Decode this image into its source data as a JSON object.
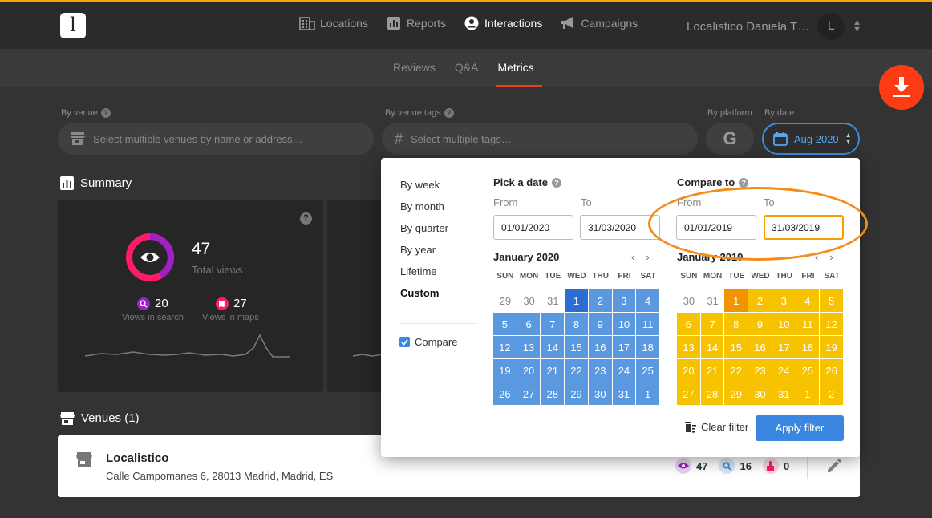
{
  "header": {
    "logo_letter": "l",
    "nav": [
      {
        "label": "Locations",
        "icon": "building-icon"
      },
      {
        "label": "Reports",
        "icon": "bar-chart-icon"
      },
      {
        "label": "Interactions",
        "icon": "user-circle-icon"
      },
      {
        "label": "Campaigns",
        "icon": "megaphone-icon"
      }
    ],
    "user_name": "Localistico Daniela T…",
    "avatar_letter": "L"
  },
  "subnav": {
    "tabs": [
      "Reviews",
      "Q&A",
      "Metrics"
    ],
    "active": "Metrics"
  },
  "filters": {
    "venue_label": "By venue",
    "venue_placeholder": "Select multiple venues by name or address…",
    "tags_label": "By venue tags",
    "tags_placeholder": "Select multiple tags…",
    "platform_label": "By platform",
    "platform_value": "G",
    "date_label": "By date",
    "date_value": "Aug 2020"
  },
  "summary": {
    "title": "Summary",
    "total_views": "47",
    "total_views_label": "Total views",
    "views_search": "20",
    "views_search_label": "Views in search",
    "views_maps": "27",
    "views_maps_label": "Views in maps",
    "help": "?"
  },
  "venues": {
    "title": "Venues (1)",
    "items": [
      {
        "name": "Localistico",
        "address": "Calle Campomanes 6, 28013 Madrid, Madrid, ES",
        "views": "47",
        "search": "16",
        "actions": "0"
      }
    ]
  },
  "date_popup": {
    "periods": [
      "By week",
      "By month",
      "By quarter",
      "By year",
      "Lifetime",
      "Custom"
    ],
    "selected_period": "Custom",
    "compare_label": "Compare",
    "pick_title": "Pick a date",
    "compare_title": "Compare to",
    "from_label": "From",
    "to_label": "To",
    "pick_from": "01/01/2020",
    "pick_to": "31/03/2020",
    "cmp_from": "01/01/2019",
    "cmp_to": "31/03/2019",
    "pick_month": "January 2020",
    "cmp_month": "January 2019",
    "dow": [
      "SUN",
      "MON",
      "TUE",
      "WED",
      "THU",
      "FRI",
      "SAT"
    ],
    "pick_days": [
      "29",
      "30",
      "31",
      "1",
      "2",
      "3",
      "4",
      "5",
      "6",
      "7",
      "8",
      "9",
      "10",
      "11",
      "12",
      "13",
      "14",
      "15",
      "16",
      "17",
      "18",
      "19",
      "20",
      "21",
      "22",
      "23",
      "24",
      "25",
      "26",
      "27",
      "28",
      "29",
      "30",
      "31",
      "1"
    ],
    "cmp_days": [
      "30",
      "31",
      "1",
      "2",
      "3",
      "4",
      "5",
      "6",
      "7",
      "8",
      "9",
      "10",
      "11",
      "12",
      "13",
      "14",
      "15",
      "16",
      "17",
      "18",
      "19",
      "20",
      "21",
      "22",
      "23",
      "24",
      "25",
      "26",
      "27",
      "28",
      "29",
      "30",
      "31",
      "1",
      "2"
    ],
    "clear_label": "Clear filter",
    "apply_label": "Apply filter"
  },
  "colors": {
    "accent_blue": "#3b86e0",
    "compare_yellow": "#f7c200",
    "brand_red": "#ff3b14",
    "highlight_orange": "#f28c1a"
  }
}
